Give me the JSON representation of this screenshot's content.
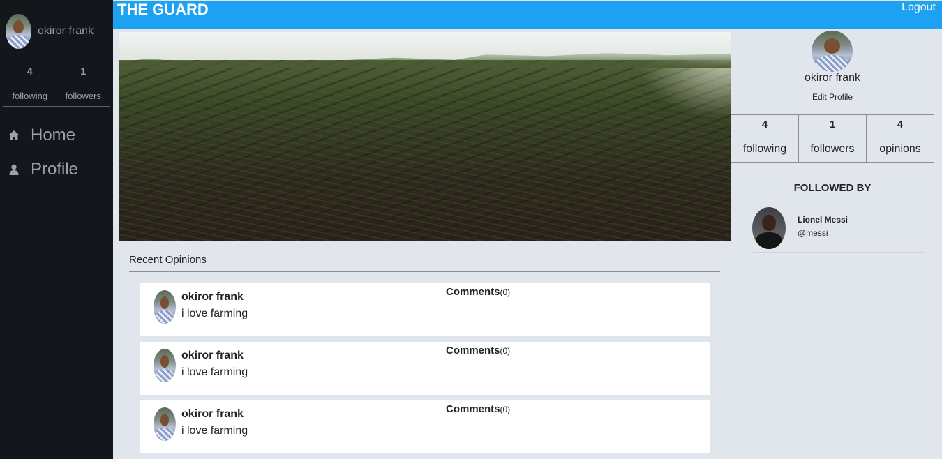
{
  "app": {
    "brand": "THE GUARD",
    "logout_label": "Logout"
  },
  "sidebar": {
    "user_name": "okiror frank",
    "stats": [
      {
        "count": "4",
        "label": "following"
      },
      {
        "count": "1",
        "label": "followers"
      }
    ],
    "nav": [
      {
        "label": "Home",
        "icon": "home-icon"
      },
      {
        "label": "Profile",
        "icon": "user-icon"
      }
    ]
  },
  "recent": {
    "title": "Recent Opinions",
    "opinions": [
      {
        "author": "okiror frank",
        "text": "i love farming",
        "comments_label": "Comments",
        "comments_count": "(0)"
      },
      {
        "author": "okiror frank",
        "text": "i love farming",
        "comments_label": "Comments",
        "comments_count": "(0)"
      },
      {
        "author": "okiror frank",
        "text": "i love farming",
        "comments_label": "Comments",
        "comments_count": "(0)"
      }
    ]
  },
  "profile": {
    "name": "okiror frank",
    "edit_label": "Edit Profile",
    "stats": [
      {
        "count": "4",
        "label": "following"
      },
      {
        "count": "1",
        "label": "followers"
      },
      {
        "count": "4",
        "label": "opinions"
      }
    ]
  },
  "followed_by": {
    "title": "FOLLOWED BY",
    "users": [
      {
        "name": "Lionel Messi",
        "handle": "@messi"
      }
    ]
  },
  "colors": {
    "header": "#1da1f2",
    "sidebar": "#13171b",
    "background": "#e1e6ec"
  }
}
